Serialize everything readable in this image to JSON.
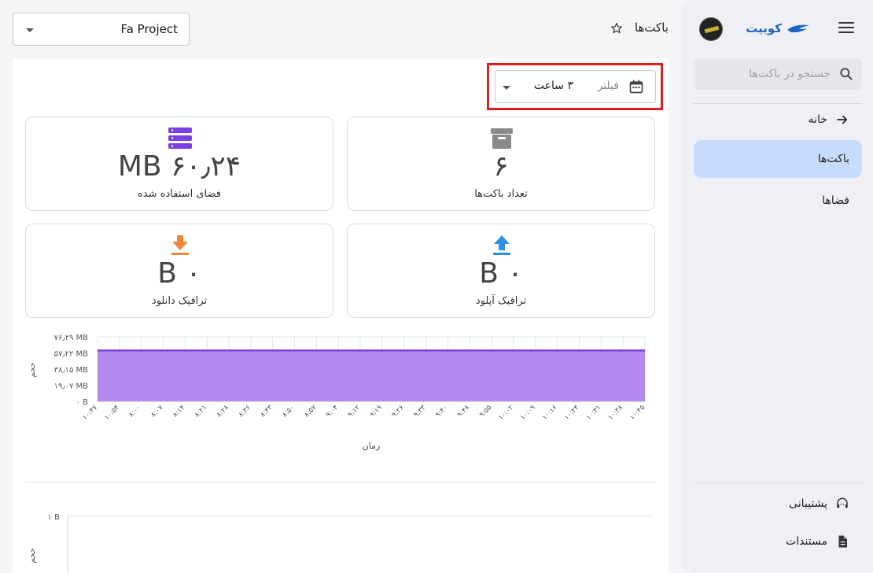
{
  "sidebar": {
    "brand": "کوبیت",
    "search_placeholder": "جستجو در باکت‌ها",
    "items": [
      {
        "label": "خانه",
        "icon": "arrow-right-icon"
      },
      {
        "label": "باکت‌ها",
        "icon": "",
        "active": true
      },
      {
        "label": "فضاها",
        "icon": ""
      }
    ],
    "bottom_items": [
      {
        "label": "پشتیبانی",
        "icon": "headset-icon"
      },
      {
        "label": "مستندات",
        "icon": "document-icon"
      }
    ]
  },
  "header": {
    "project": "Fa Project",
    "title": "باکت‌ها"
  },
  "filter": {
    "label": "فیلتر",
    "value": "۳ ساعت"
  },
  "cards": {
    "buckets": {
      "value": "۶",
      "label": "تعداد باکت‌ها",
      "icon": "archive-icon",
      "color": "#8a8a8a"
    },
    "space": {
      "value": "۶۰٫۲۴ MB",
      "label": "فضای استفاده شده",
      "icon": "storage-icon",
      "color": "#7b3fe4"
    },
    "upload": {
      "value": "۰ B",
      "label": "ترافیک آپلود",
      "icon": "upload-icon",
      "color": "#2d8fe6"
    },
    "download": {
      "value": "۰ B",
      "label": "ترافیک دانلود",
      "icon": "download-icon",
      "color": "#f0873a"
    }
  },
  "chart_data": [
    {
      "type": "area",
      "xlabel": "زمان",
      "ylabel": "حجم",
      "y_ticks": [
        "۰ B",
        "۱۹٫۰۷ MB",
        "۳۸٫۱۵ MB",
        "۵۷٫۲۲ MB",
        "۷۶٫۲۹ MB"
      ],
      "ylim": [
        0,
        76.29
      ],
      "x": [
        "۱۰:۴۷",
        "۱۰:۵۴",
        "۸:۰۰",
        "۸:۰۷",
        "۸:۱۴",
        "۸:۲۱",
        "۸:۲۸",
        "۸:۳۶",
        "۸:۴۳",
        "۸:۵۰",
        "۸:۵۷",
        "۹:۰۴",
        "۹:۱۲",
        "۹:۱۹",
        "۹:۲۶",
        "۹:۳۳",
        "۹:۴۰",
        "۹:۴۸",
        "۹:۵۵",
        "۱۰:۰۲",
        "۱۰:۰۹",
        "۱۰:۱۶",
        "۱۰:۲۴",
        "۱۰:۳۱",
        "۱۰:۳۸",
        "۱۰:۴۵"
      ],
      "series": [
        {
          "values": [
            60.24,
            60.24,
            60.24,
            60.24,
            60.24,
            60.24,
            60.24,
            60.24,
            60.24,
            60.24,
            60.24,
            60.24,
            60.24,
            60.24,
            60.24,
            60.24,
            60.24,
            60.24,
            60.24,
            60.24,
            60.24,
            60.24,
            60.24,
            60.24,
            60.24,
            60.24
          ],
          "color": "#7b3fe4",
          "fill": "#b48af0"
        }
      ],
      "grid": true
    },
    {
      "type": "line",
      "ylabel": "حجم",
      "y_ticks": [
        "۱ B"
      ],
      "grid": true
    }
  ]
}
